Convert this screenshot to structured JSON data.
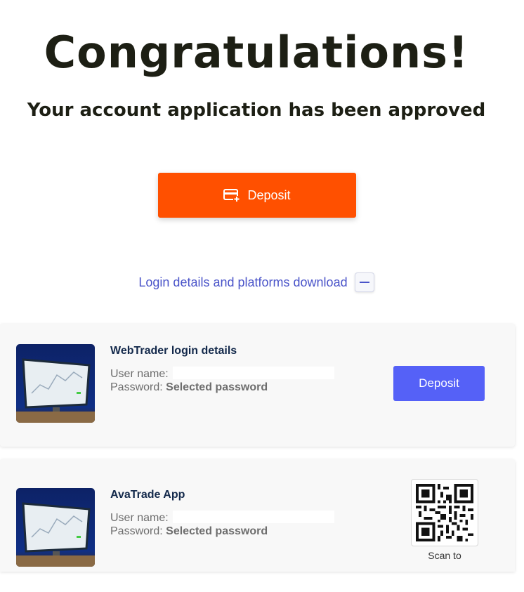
{
  "header": {
    "title": "Congratulations!",
    "subtitle": "Your account application has been approved"
  },
  "primary_action": {
    "label": "Deposit",
    "icon": "card-plus-icon",
    "color": "#ff5000"
  },
  "login_section": {
    "label": "Login details and platforms download",
    "toggle_icon": "minus-icon"
  },
  "cards": [
    {
      "title": "WebTrader login details",
      "username_label": "User name:",
      "username_value": "",
      "password_label": "Password:",
      "password_value": "Selected password",
      "action_label": "Deposit",
      "action_color": "#5561f7"
    },
    {
      "title": "AvaTrade App",
      "username_label": "User name:",
      "username_value": "",
      "password_label": "Password:",
      "password_value": "Selected password",
      "qr_caption": "Scan to"
    }
  ]
}
